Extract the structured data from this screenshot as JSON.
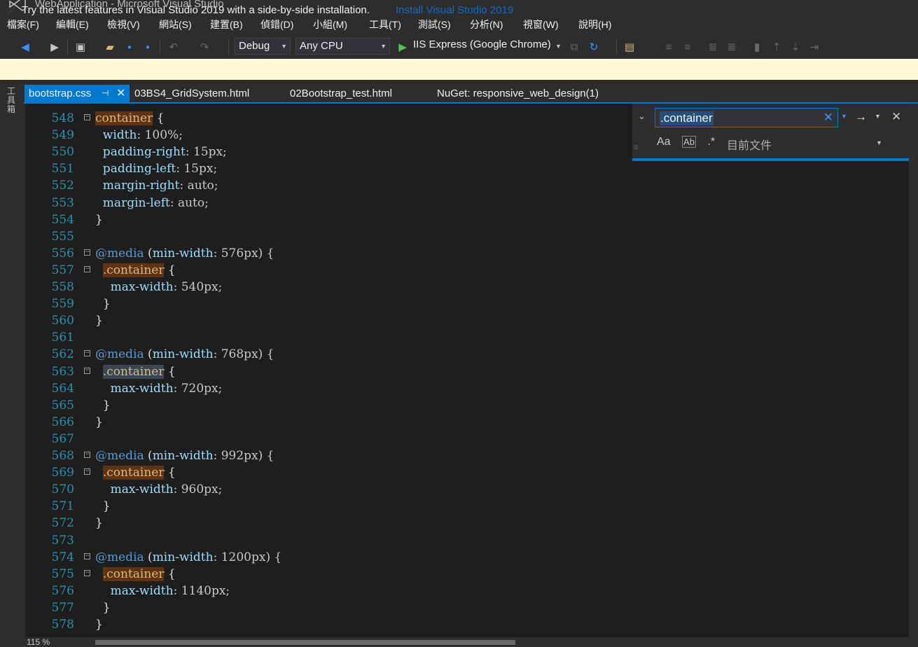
{
  "window": {
    "title": "WebApplication - Microsoft Visual Studio"
  },
  "menu": [
    "檔案(F)",
    "編輯(E)",
    "檢視(V)",
    "網站(S)",
    "建置(B)",
    "偵錯(D)",
    "小組(M)",
    "工具(T)",
    "測試(S)",
    "分析(N)",
    "視窗(W)",
    "說明(H)"
  ],
  "toolbar": {
    "config": "Debug",
    "platform": "Any CPU",
    "run_target": "IIS Express (Google Chrome)"
  },
  "infobar": {
    "message": "Try the latest features in Visual Studio 2019 with a side-by-side installation.",
    "link": "Install Visual Studio 2019"
  },
  "toolbox_label": "工具箱",
  "tabs": [
    {
      "label": "bootstrap.css",
      "pin_icon": "pin-icon",
      "close_icon": "close-icon",
      "active": true
    },
    {
      "label": "03BS4_GridSystem.html"
    },
    {
      "label": "02Bootstrap_test.html"
    },
    {
      "label": "NuGet: responsive_web_design(1)"
    }
  ],
  "find": {
    "query": ".container",
    "clear_glyph": "✕",
    "options": {
      "match_case": "Aa",
      "whole_word": "Ab",
      "regex": ".*"
    },
    "scope": "目前文件"
  },
  "editor": {
    "zoom": "115 %",
    "lines": [
      {
        "n": "548",
        "fold": "⊟",
        "segs": [
          [
            "container",
            "sel hl"
          ],
          [
            " {",
            "punc"
          ]
        ]
      },
      {
        "n": "549",
        "segs": [
          [
            "  width",
            "prop"
          ],
          [
            ": 100%;",
            "val"
          ]
        ]
      },
      {
        "n": "550",
        "segs": [
          [
            "  padding-right",
            "prop"
          ],
          [
            ": 15px;",
            "val"
          ]
        ]
      },
      {
        "n": "551",
        "segs": [
          [
            "  padding-left",
            "prop"
          ],
          [
            ": 15px;",
            "val"
          ]
        ]
      },
      {
        "n": "552",
        "segs": [
          [
            "  margin-right",
            "prop"
          ],
          [
            ": auto;",
            "val"
          ]
        ]
      },
      {
        "n": "553",
        "segs": [
          [
            "  margin-left",
            "prop"
          ],
          [
            ": auto;",
            "val"
          ]
        ]
      },
      {
        "n": "554",
        "segs": [
          [
            "}",
            "punc"
          ]
        ]
      },
      {
        "n": "555",
        "segs": []
      },
      {
        "n": "556",
        "fold": "⊟",
        "segs": [
          [
            "@media",
            "at"
          ],
          [
            " (",
            "punc"
          ],
          [
            "min-width",
            "prop"
          ],
          [
            ": 576px) {",
            "val"
          ]
        ]
      },
      {
        "n": "557",
        "fold": "⊟",
        "segs": [
          [
            "  ",
            "punc"
          ],
          [
            ".container",
            "sel hl"
          ],
          [
            " {",
            "punc"
          ]
        ]
      },
      {
        "n": "558",
        "segs": [
          [
            "    max-width",
            "prop"
          ],
          [
            ": 540px;",
            "val"
          ]
        ]
      },
      {
        "n": "559",
        "segs": [
          [
            "  }",
            "punc"
          ]
        ]
      },
      {
        "n": "560",
        "segs": [
          [
            "}",
            "punc"
          ]
        ]
      },
      {
        "n": "561",
        "segs": []
      },
      {
        "n": "562",
        "fold": "⊟",
        "segs": [
          [
            "@media",
            "at"
          ],
          [
            " (",
            "punc"
          ],
          [
            "min-width",
            "prop"
          ],
          [
            ": 768px) {",
            "val"
          ]
        ]
      },
      {
        "n": "563",
        "fold": "⊟",
        "segs": [
          [
            "  ",
            "punc"
          ],
          [
            ".container",
            "sel hlsel"
          ],
          [
            " {",
            "punc"
          ]
        ]
      },
      {
        "n": "564",
        "segs": [
          [
            "    max-width",
            "prop"
          ],
          [
            ": 720px;",
            "val"
          ]
        ]
      },
      {
        "n": "565",
        "segs": [
          [
            "  }",
            "punc"
          ]
        ]
      },
      {
        "n": "566",
        "segs": [
          [
            "}",
            "punc"
          ]
        ]
      },
      {
        "n": "567",
        "segs": []
      },
      {
        "n": "568",
        "fold": "⊟",
        "segs": [
          [
            "@media",
            "at"
          ],
          [
            " (",
            "punc"
          ],
          [
            "min-width",
            "prop"
          ],
          [
            ": 992px) {",
            "val"
          ]
        ]
      },
      {
        "n": "569",
        "fold": "⊟",
        "segs": [
          [
            "  ",
            "punc"
          ],
          [
            ".container",
            "sel hl"
          ],
          [
            " {",
            "punc"
          ]
        ]
      },
      {
        "n": "570",
        "segs": [
          [
            "    max-width",
            "prop"
          ],
          [
            ": 960px;",
            "val"
          ]
        ]
      },
      {
        "n": "571",
        "segs": [
          [
            "  }",
            "punc"
          ]
        ]
      },
      {
        "n": "572",
        "segs": [
          [
            "}",
            "punc"
          ]
        ]
      },
      {
        "n": "573",
        "segs": []
      },
      {
        "n": "574",
        "fold": "⊟",
        "segs": [
          [
            "@media",
            "at"
          ],
          [
            " (",
            "punc"
          ],
          [
            "min-width",
            "prop"
          ],
          [
            ": 1200px) {",
            "val"
          ]
        ]
      },
      {
        "n": "575",
        "fold": "⊟",
        "segs": [
          [
            "  ",
            "punc"
          ],
          [
            ".container",
            "sel hl"
          ],
          [
            " {",
            "punc"
          ]
        ]
      },
      {
        "n": "576",
        "segs": [
          [
            "    max-width",
            "prop"
          ],
          [
            ": 1140px;",
            "val"
          ]
        ]
      },
      {
        "n": "577",
        "segs": [
          [
            "  }",
            "punc"
          ]
        ]
      },
      {
        "n": "578",
        "segs": [
          [
            "}",
            "punc"
          ]
        ]
      }
    ]
  }
}
